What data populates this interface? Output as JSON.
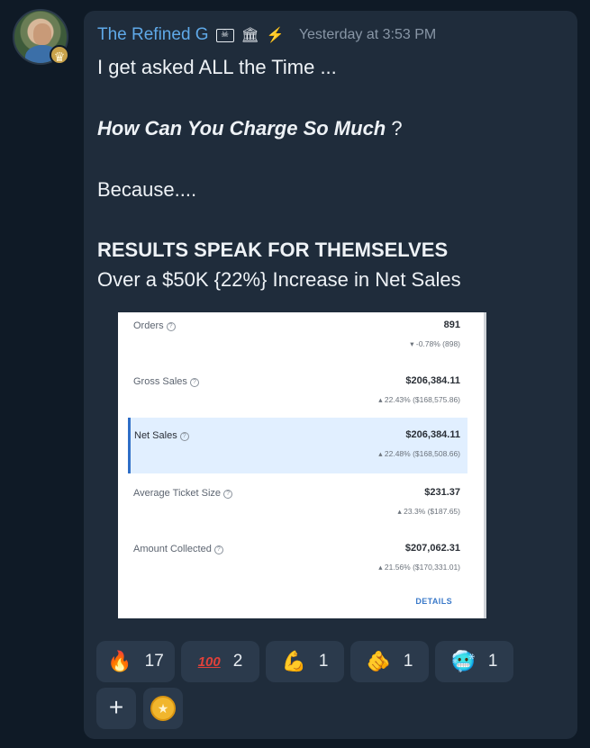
{
  "post": {
    "username": "The Refined G",
    "timestamp": "Yesterday at 3:53 PM",
    "badges": [
      "pirate-flag",
      "bank",
      "lightning"
    ],
    "lines": {
      "line1": "I get asked ALL the Time ...",
      "line2_emph": "How Can You Charge So Much",
      "line2_tail": " ?",
      "line3": "Because....",
      "line4": "RESULTS SPEAK FOR THEMSELVES",
      "line5": "Over a $50K {22%} Increase in Net Sales"
    }
  },
  "screenshot": {
    "rows": [
      {
        "label": "Orders",
        "value": "891",
        "change": "▾ -0.78%  (898)"
      },
      {
        "label": "Gross Sales",
        "value": "$206,384.11",
        "change": "▴ 22.43%  ($168,575.86)"
      },
      {
        "label": "Net Sales",
        "value": "$206,384.11",
        "change": "▴ 22.48%  ($168,508.66)"
      },
      {
        "label": "Average Ticket Size",
        "value": "$231.37",
        "change": "▴ 23.3%  ($187.65)"
      },
      {
        "label": "Amount Collected",
        "value": "$207,062.31",
        "change": "▴ 21.56%  ($170,331.01)"
      }
    ],
    "details_label": "DETAILS"
  },
  "reactions": [
    {
      "icon": "🔥",
      "count": "1​7"
    },
    {
      "icon": "💯",
      "count": "2"
    },
    {
      "icon": "💪",
      "count": "1"
    },
    {
      "icon": "🫵",
      "count": "1"
    },
    {
      "icon": "🥶",
      "count": "1"
    }
  ],
  "actions": {
    "add": "+",
    "coin": "★"
  },
  "colors": {
    "username": "#5fa9e8",
    "bubble": "#1f2c3b",
    "highlight": "#e1efff"
  }
}
